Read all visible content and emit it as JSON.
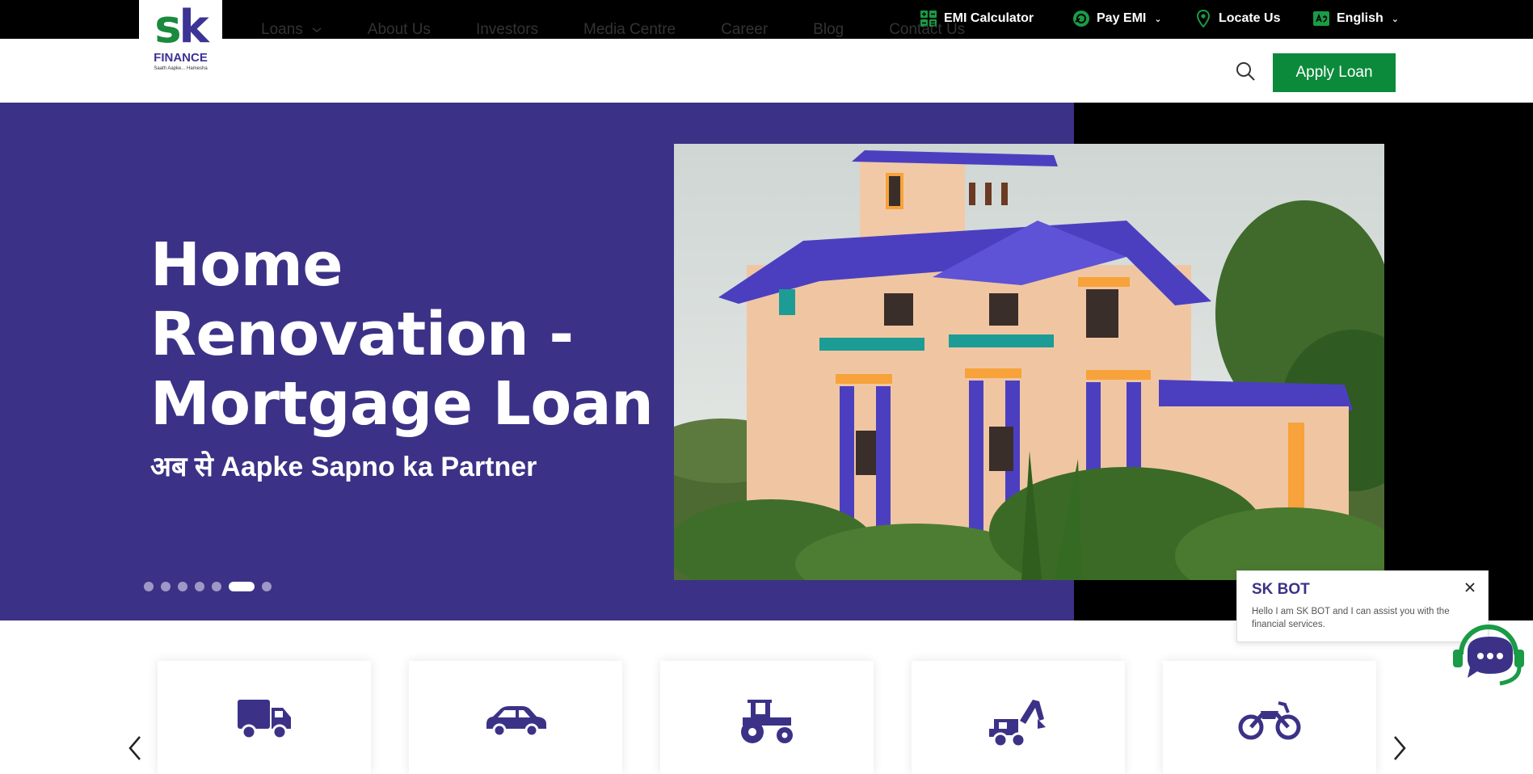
{
  "topbar": {
    "emi_calculator": "EMI Calculator",
    "pay_emi": "Pay EMI",
    "locate_us": "Locate Us",
    "language": "English"
  },
  "brand": {
    "logo_s": "s",
    "logo_k": "k",
    "logo_word": "FINANCE",
    "logo_tagline": "Saath Aapke... Hamesha"
  },
  "nav": {
    "items": [
      "Loans",
      "About Us",
      "Investors",
      "Media Centre",
      "Career",
      "Blog",
      "Contact Us"
    ],
    "apply_label": "Apply Loan"
  },
  "hero": {
    "title": "Home Renovation - Mortgage Loan",
    "subtitle": "अब से Aapke Sapno ka Partner",
    "slide_count": 7,
    "active_slide": 6
  },
  "cards": {
    "icons": [
      "truck-icon",
      "car-icon",
      "tractor-icon",
      "construction-equipment-icon",
      "motorcycle-icon"
    ]
  },
  "chatbot": {
    "title": "SK BOT",
    "message": "Hello I am SK BOT and I can assist you with the financial services."
  },
  "colors": {
    "brand_purple": "#3b3287",
    "brand_green": "#0b8a3b",
    "topbar": "#000000"
  }
}
